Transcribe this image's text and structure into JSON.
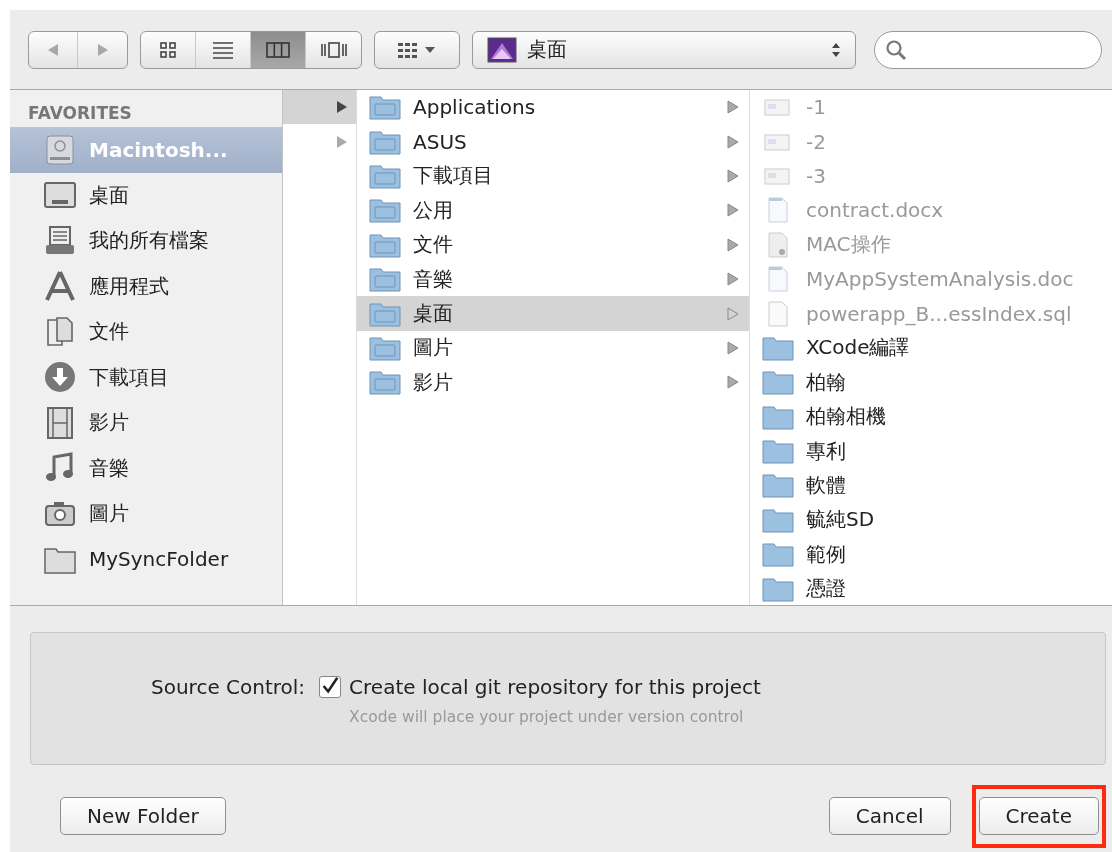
{
  "toolbar": {
    "nav": [
      {
        "kind": "back",
        "disabled": true
      },
      {
        "kind": "forward",
        "disabled": true
      }
    ],
    "views": [
      {
        "kind": "icons",
        "selected": false
      },
      {
        "kind": "list",
        "selected": false
      },
      {
        "kind": "columns",
        "selected": true
      },
      {
        "kind": "coverflow",
        "selected": false
      }
    ],
    "path": {
      "label": "桌面"
    }
  },
  "sidebar": {
    "heading": "FAVORITES",
    "items": [
      {
        "label": "Macintosh...",
        "kind": "drive",
        "selected": true
      },
      {
        "label": "桌面",
        "kind": "desktop",
        "selected": false
      },
      {
        "label": "我的所有檔案",
        "kind": "allfiles",
        "selected": false
      },
      {
        "label": "應用程式",
        "kind": "apps",
        "selected": false
      },
      {
        "label": "文件",
        "kind": "documents",
        "selected": false
      },
      {
        "label": "下載項目",
        "kind": "downloads",
        "selected": false
      },
      {
        "label": "影片",
        "kind": "movies",
        "selected": false
      },
      {
        "label": "音樂",
        "kind": "music",
        "selected": false
      },
      {
        "label": "圖片",
        "kind": "pictures",
        "selected": false
      },
      {
        "label": "MySyncFolder",
        "kind": "folder",
        "selected": false
      }
    ]
  },
  "column_1": [
    {
      "selected": true
    },
    {
      "selected": false
    }
  ],
  "column_2": [
    {
      "label": "Applications",
      "selected": false
    },
    {
      "label": "ASUS",
      "selected": false
    },
    {
      "label": "下載項目",
      "selected": false
    },
    {
      "label": "公用",
      "selected": false
    },
    {
      "label": "文件",
      "selected": false
    },
    {
      "label": "音樂",
      "selected": false
    },
    {
      "label": "桌面",
      "selected": true
    },
    {
      "label": "圖片",
      "selected": false
    },
    {
      "label": "影片",
      "selected": false
    }
  ],
  "column_3": [
    {
      "label": "-1",
      "kind": "image",
      "disabled": true
    },
    {
      "label": "-2",
      "kind": "image",
      "disabled": true
    },
    {
      "label": "-3",
      "kind": "image",
      "disabled": true
    },
    {
      "label": "contract.docx",
      "kind": "document",
      "disabled": true
    },
    {
      "label": "MAC操作",
      "kind": "preview",
      "disabled": true
    },
    {
      "label": "MyAppSystemAnalysis.doc",
      "kind": "document",
      "disabled": true
    },
    {
      "label": "powerapp_B...essIndex.sql",
      "kind": "file",
      "disabled": true
    },
    {
      "label": "XCode編譯",
      "kind": "folder",
      "disabled": false
    },
    {
      "label": "柏翰",
      "kind": "folder",
      "disabled": false
    },
    {
      "label": "柏翰相機",
      "kind": "folder",
      "disabled": false
    },
    {
      "label": "專利",
      "kind": "folder",
      "disabled": false
    },
    {
      "label": "軟體",
      "kind": "folder",
      "disabled": false
    },
    {
      "label": "毓純SD",
      "kind": "folder",
      "disabled": false
    },
    {
      "label": "範例",
      "kind": "folder",
      "disabled": false
    },
    {
      "label": "憑證",
      "kind": "folder",
      "disabled": false
    }
  ],
  "source_control": {
    "label": "Source Control:",
    "checkbox": {
      "label": "Create local git repository for this project",
      "checked": true
    },
    "hint": "Xcode will place your project under version control"
  },
  "buttons": [
    {
      "label": "New Folder",
      "highlighted": false
    },
    {
      "label": "Cancel",
      "highlighted": false
    },
    {
      "label": "Create",
      "highlighted": true
    }
  ]
}
